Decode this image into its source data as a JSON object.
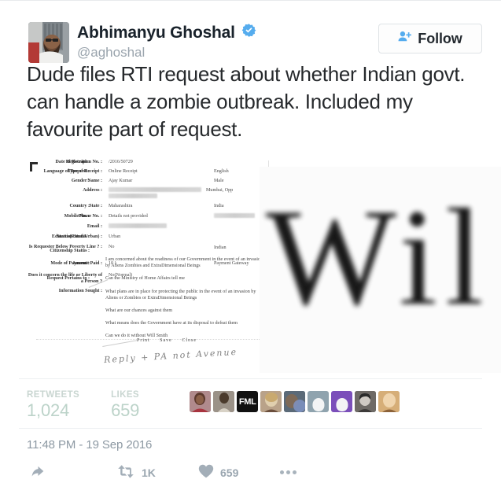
{
  "platform": "twitter",
  "account": {
    "display_name": "Abhimanyu Ghoshal",
    "handle": "@aghoshal",
    "verified_badge_icon": "verified-check-icon",
    "avatar_icon": "user-avatar-photo"
  },
  "follow_button": {
    "label": "Follow",
    "icon": "person-add-icon",
    "accent_color": "#55acee"
  },
  "tweet": {
    "text": "Dude files RTI request about whether Indian govt. can handle a zombie outbreak. Included my favourite part of request.",
    "timestamp": "11:48 PM - 19 Sep 2016"
  },
  "media": {
    "kind": "document-screenshot",
    "zoom_overlay_text": "Wil",
    "document": {
      "fields_left": [
        {
          "label": "Registration No. :",
          "value": "/2016/50729"
        },
        {
          "label": "Type of Receipt :",
          "value": "Online Receipt"
        },
        {
          "label": "Name :",
          "value": "Ajay Kumar"
        },
        {
          "label": "Address :",
          "value": "Mumbai, Opp",
          "redacted": true
        },
        {
          "label": "State :",
          "value": "Maharashtra"
        },
        {
          "label": "Phone No. :",
          "value": "Details not provided"
        },
        {
          "label": "Email :",
          "value": "",
          "redacted": true
        },
        {
          "label": "Status(Rural/Urban) :",
          "value": "Urban"
        },
        {
          "label": "Is Requester Below Poverty Line ? :",
          "value": "No"
        },
        {
          "label": "Amount Paid :",
          "value": "10 )"
        },
        {
          "label": "Does it concern the life or Liberty of a Person ?",
          "value": "No(Normal)"
        }
      ],
      "fields_right": [
        {
          "label": "Date of Receipt :",
          "value": ""
        },
        {
          "label": "Language of Request :",
          "value": "English"
        },
        {
          "label": "Gender :",
          "value": "Male"
        },
        {
          "label": "Country :",
          "value": "India"
        },
        {
          "label": "Mobile No. :",
          "value": "",
          "redacted": true
        },
        {
          "label": "Education Status :",
          "value": ""
        },
        {
          "label": "Citizenship Status :",
          "value": "Indian"
        },
        {
          "label": "Mode of Payment :",
          "value": "Payment Gateway"
        },
        {
          "label": "Request Pertains to :",
          "value": ""
        }
      ],
      "information_sought_label": "Information Sought :",
      "request_paragraphs": [
        "I am concerned about the readiness of our Government in the event of an invasion by Aliens Zombies and ExtraDimensional Beings",
        "Can the Ministry of Home Affairs tell me",
        "What plans are in place for protecting the public in the event of an invasion by Aliens or Zombies or ExtraDimensional Beings",
        "What are our chances against them",
        "What means does the Government have at its disposal to defeat them",
        "Can we do it without Will Smith"
      ],
      "buttons": [
        "Print",
        "Save",
        "Close"
      ],
      "handwritten_note": "Reply + PA not Avenue"
    }
  },
  "stats": {
    "retweets_label": "RETWEETS",
    "retweets_value": "1,024",
    "likes_label": "LIKES",
    "likes_value": "659",
    "facepile_count": 9,
    "facepile": [
      {
        "name": "avatar-1",
        "type": "photo",
        "bg": "#6f4a4d"
      },
      {
        "name": "avatar-2",
        "type": "photo",
        "bg": "#8b8377"
      },
      {
        "name": "avatar-3",
        "type": "text",
        "text": "FML",
        "bg": "#111111"
      },
      {
        "name": "avatar-4",
        "type": "photo",
        "bg": "#7d6a5c"
      },
      {
        "name": "avatar-5",
        "type": "photo",
        "bg": "#4c5b6b"
      },
      {
        "name": "avatar-6",
        "type": "blob",
        "bg": "#8fa3ae"
      },
      {
        "name": "avatar-7",
        "type": "blob",
        "bg": "#7b4fba"
      },
      {
        "name": "avatar-8",
        "type": "photo",
        "bg": "#5d5a57"
      },
      {
        "name": "avatar-9",
        "type": "photo",
        "bg": "#c9a06a"
      }
    ]
  },
  "actions": {
    "reply_icon": "reply-arrow-icon",
    "reply_count": "",
    "retweet_icon": "retweet-icon",
    "retweet_count": "1K",
    "like_icon": "heart-icon",
    "like_count": "659",
    "more_icon": "more-dots-icon"
  },
  "colors": {
    "twitter_blue": "#55acee",
    "text_primary": "#26292c",
    "text_muted": "#8d99a3",
    "icon_grey": "#a3aeb8",
    "stat_tint": "#bcd3c9",
    "border": "#e8eaec"
  }
}
